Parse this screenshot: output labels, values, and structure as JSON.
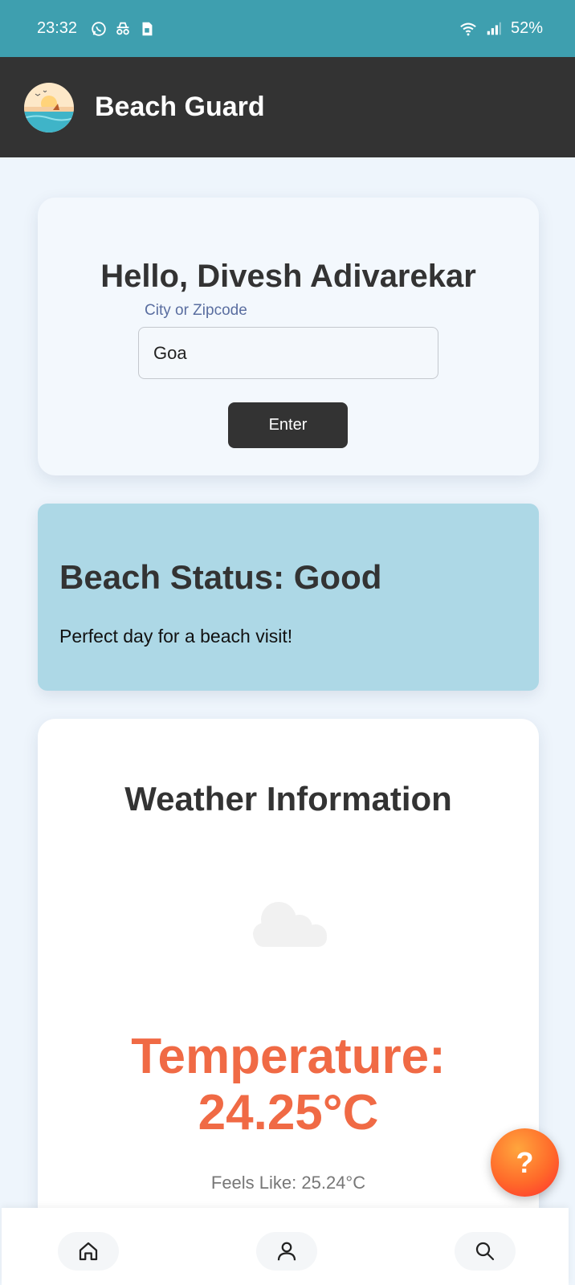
{
  "status_bar": {
    "time": "23:32",
    "battery": "52%",
    "icons": [
      "whatsapp-icon",
      "incognito-icon",
      "sim-icon",
      "wifi-icon",
      "signal-icon"
    ]
  },
  "app_bar": {
    "title": "Beach Guard",
    "logo": "beach-logo"
  },
  "search_card": {
    "greeting": "Hello, Divesh Adivarekar",
    "field_label": "City or Zipcode",
    "field_value": "Goa",
    "button_label": "Enter"
  },
  "beach_status": {
    "title": "Beach Status: Good",
    "message": "Perfect day for a beach visit!"
  },
  "weather": {
    "title": "Weather Information",
    "icon": "cloud-icon",
    "temperature_line1": "Temperature:",
    "temperature_line2": "24.25°C",
    "feels_like": "Feels Like: 25.24°C"
  },
  "help_fab": {
    "label": "?"
  },
  "bottom_nav": {
    "items": [
      "home-icon",
      "profile-icon",
      "search-icon"
    ]
  },
  "colors": {
    "status_bar": "#3e9faf",
    "app_bar": "#333333",
    "status_card": "#add8e6",
    "temperature": "#f06a45",
    "background": "#eef5fc"
  }
}
